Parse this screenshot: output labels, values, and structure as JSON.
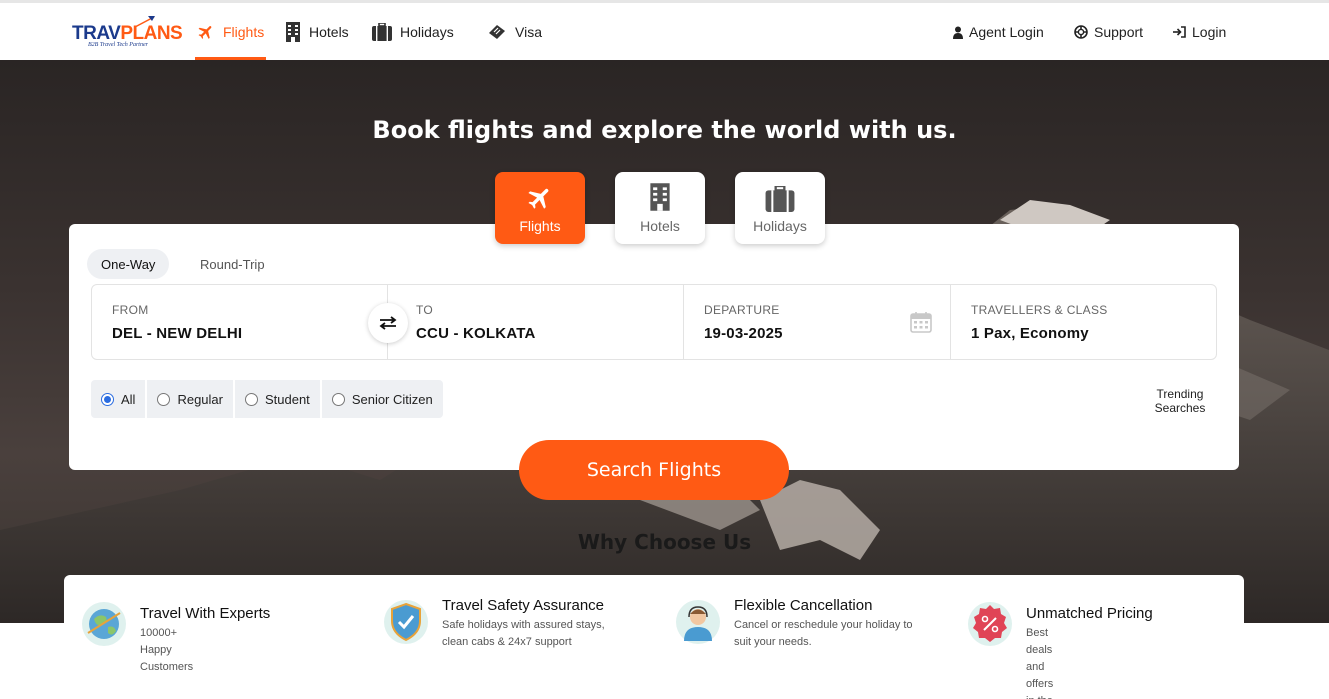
{
  "brand": {
    "logo_part1": "TRAV",
    "logo_part2": "PLANS",
    "tagline": "B2B Travel Tech Partner"
  },
  "nav": {
    "items": [
      {
        "label": "Flights",
        "icon": "plane-icon",
        "active": true
      },
      {
        "label": "Hotels",
        "icon": "building-icon",
        "active": false
      },
      {
        "label": "Holidays",
        "icon": "suitcase-icon",
        "active": false
      },
      {
        "label": "Visa",
        "icon": "ticket-icon",
        "active": false
      }
    ],
    "right": [
      {
        "label": "Agent Login",
        "icon": "user-icon"
      },
      {
        "label": "Support",
        "icon": "lifebuoy-icon"
      },
      {
        "label": "Login",
        "icon": "sign-in-icon"
      }
    ]
  },
  "hero": {
    "title": "Book flights and explore the world with us."
  },
  "product_tabs": [
    {
      "label": "Flights",
      "icon": "plane-icon",
      "active": true
    },
    {
      "label": "Hotels",
      "icon": "building-icon",
      "active": false
    },
    {
      "label": "Holidays",
      "icon": "suitcase-icon",
      "active": false
    }
  ],
  "search": {
    "trip_types": [
      {
        "label": "One-Way",
        "active": true
      },
      {
        "label": "Round-Trip",
        "active": false
      }
    ],
    "from": {
      "label": "FROM",
      "value": "DEL - NEW DELHI"
    },
    "to": {
      "label": "TO",
      "value": "CCU - KOLKATA"
    },
    "departure": {
      "label": "DEPARTURE",
      "value": "19-03-2025"
    },
    "travellers": {
      "label": "TRAVELLERS & CLASS",
      "value": "1 Pax, Economy"
    },
    "fare_types": [
      {
        "label": "All",
        "selected": true
      },
      {
        "label": "Regular",
        "selected": false
      },
      {
        "label": "Student",
        "selected": false
      },
      {
        "label": "Senior Citizen",
        "selected": false
      }
    ],
    "trending_line1": "Trending",
    "trending_line2": "Searches",
    "submit_label": "Search Flights"
  },
  "why": {
    "heading": "Why Choose Us",
    "features": [
      {
        "title": "Travel With Experts",
        "desc1": "10000+ Happy Customers",
        "desc2": "",
        "icon": "globe-icon"
      },
      {
        "title": "Travel Safety Assurance",
        "desc1": "Safe holidays with assured stays,",
        "desc2": "clean cabs & 24x7 support",
        "icon": "shield-icon"
      },
      {
        "title": "Flexible Cancellation",
        "desc1": "Cancel or reschedule your holiday to",
        "desc2": "suit your needs.",
        "icon": "support-agent-icon"
      },
      {
        "title": "Unmatched Pricing",
        "desc1": "Best deals and offers in the industry",
        "desc2": "",
        "icon": "discount-badge-icon"
      }
    ]
  },
  "colors": {
    "accent": "#ff5a14",
    "brand_blue": "#1b3a8c",
    "radio_blue": "#2a6ce0"
  }
}
